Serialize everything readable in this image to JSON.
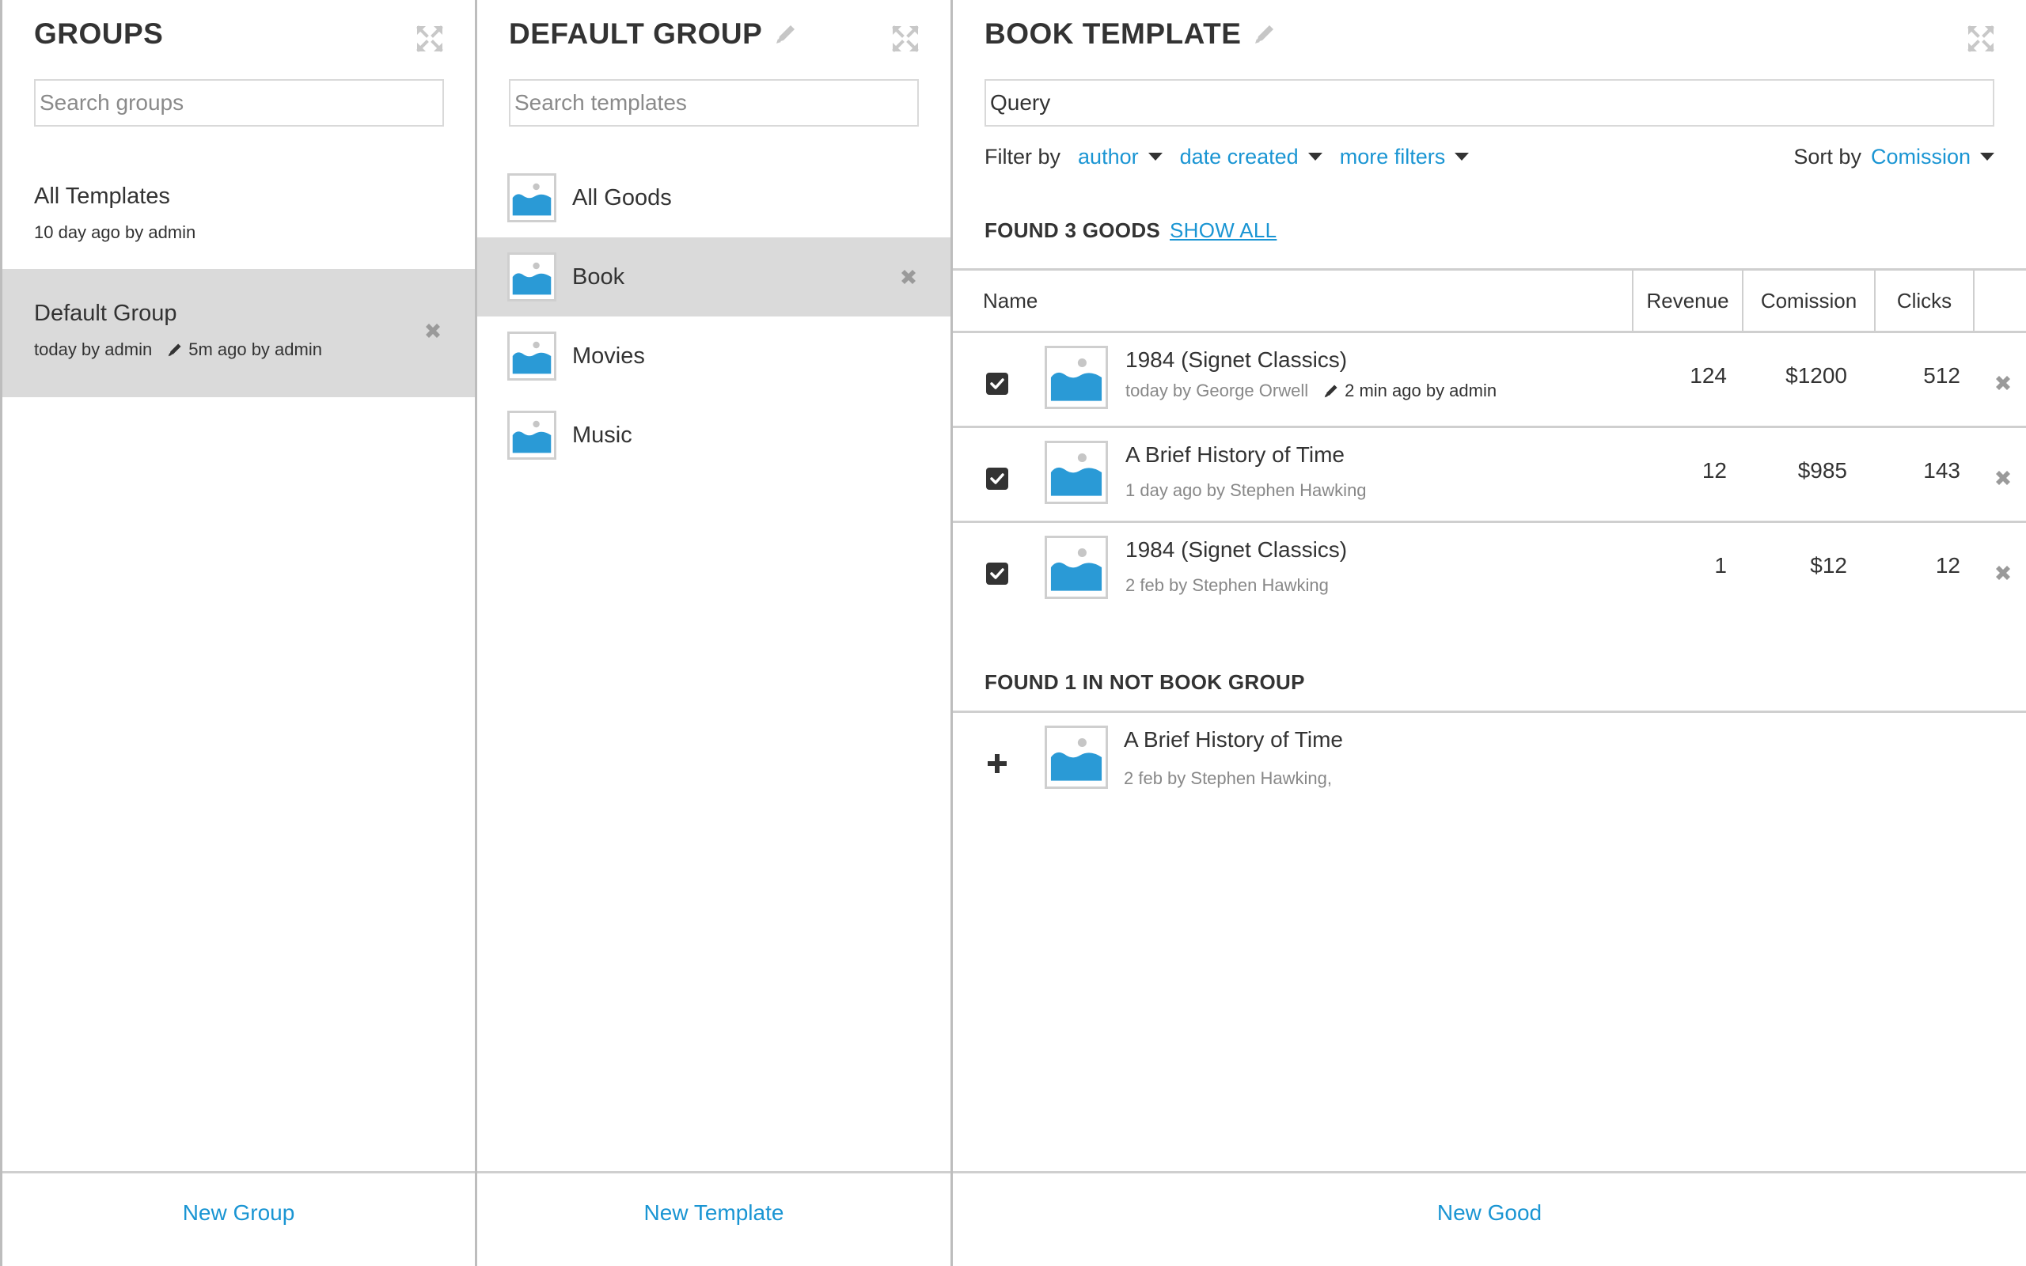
{
  "groups_panel": {
    "title": "GROUPS",
    "search_placeholder": "Search groups",
    "items": [
      {
        "name": "All Templates",
        "created": "10 day ago by admin",
        "edited": ""
      },
      {
        "name": "Default Group",
        "created": "today by admin",
        "edited": "5m ago by admin",
        "selected": true
      }
    ],
    "footer_label": "New Group"
  },
  "templates_panel": {
    "title": "DEFAULT GROUP",
    "search_placeholder": "Search templates",
    "items": [
      {
        "name": "All Goods"
      },
      {
        "name": "Book",
        "selected": true
      },
      {
        "name": "Movies"
      },
      {
        "name": "Music"
      }
    ],
    "footer_label": "New Template"
  },
  "goods_panel": {
    "title": "BOOK TEMPLATE",
    "search_value": "Query",
    "filter_label": "Filter by",
    "filters": [
      "author",
      "date created",
      "more filters"
    ],
    "sort_label": "Sort by",
    "sort_value": "Comission",
    "found_heading": "FOUND 3 GOODS",
    "show_all": "SHOW ALL",
    "columns": {
      "name": "Name",
      "revenue": "Revenue",
      "commission": "Comission",
      "clicks": "Clicks"
    },
    "rows": [
      {
        "title": "1984 (Signet Classics)",
        "created": "today by George Orwell",
        "edited": "2 min ago by admin",
        "revenue": "124",
        "commission": "$1200",
        "clicks": "512",
        "checked": true
      },
      {
        "title": "A Brief History of Time",
        "created": "1 day ago by Stephen Hawking",
        "edited": "",
        "revenue": "12",
        "commission": "$985",
        "clicks": "143",
        "checked": true
      },
      {
        "title": "1984 (Signet Classics)",
        "created": "2 feb by Stephen Hawking",
        "edited": "",
        "revenue": "1",
        "commission": "$12",
        "clicks": "12",
        "checked": true
      }
    ],
    "other_heading": "FOUND 1 IN NOT BOOK GROUP",
    "other_rows": [
      {
        "title": "A Brief History of Time",
        "created": "2 feb by Stephen Hawking,"
      }
    ],
    "footer_label": "New Good"
  },
  "colors": {
    "accent": "#1a95d3",
    "selected_bg": "#dadada",
    "thumb_fill": "#2a9ad6",
    "border": "#cfcfcf"
  }
}
